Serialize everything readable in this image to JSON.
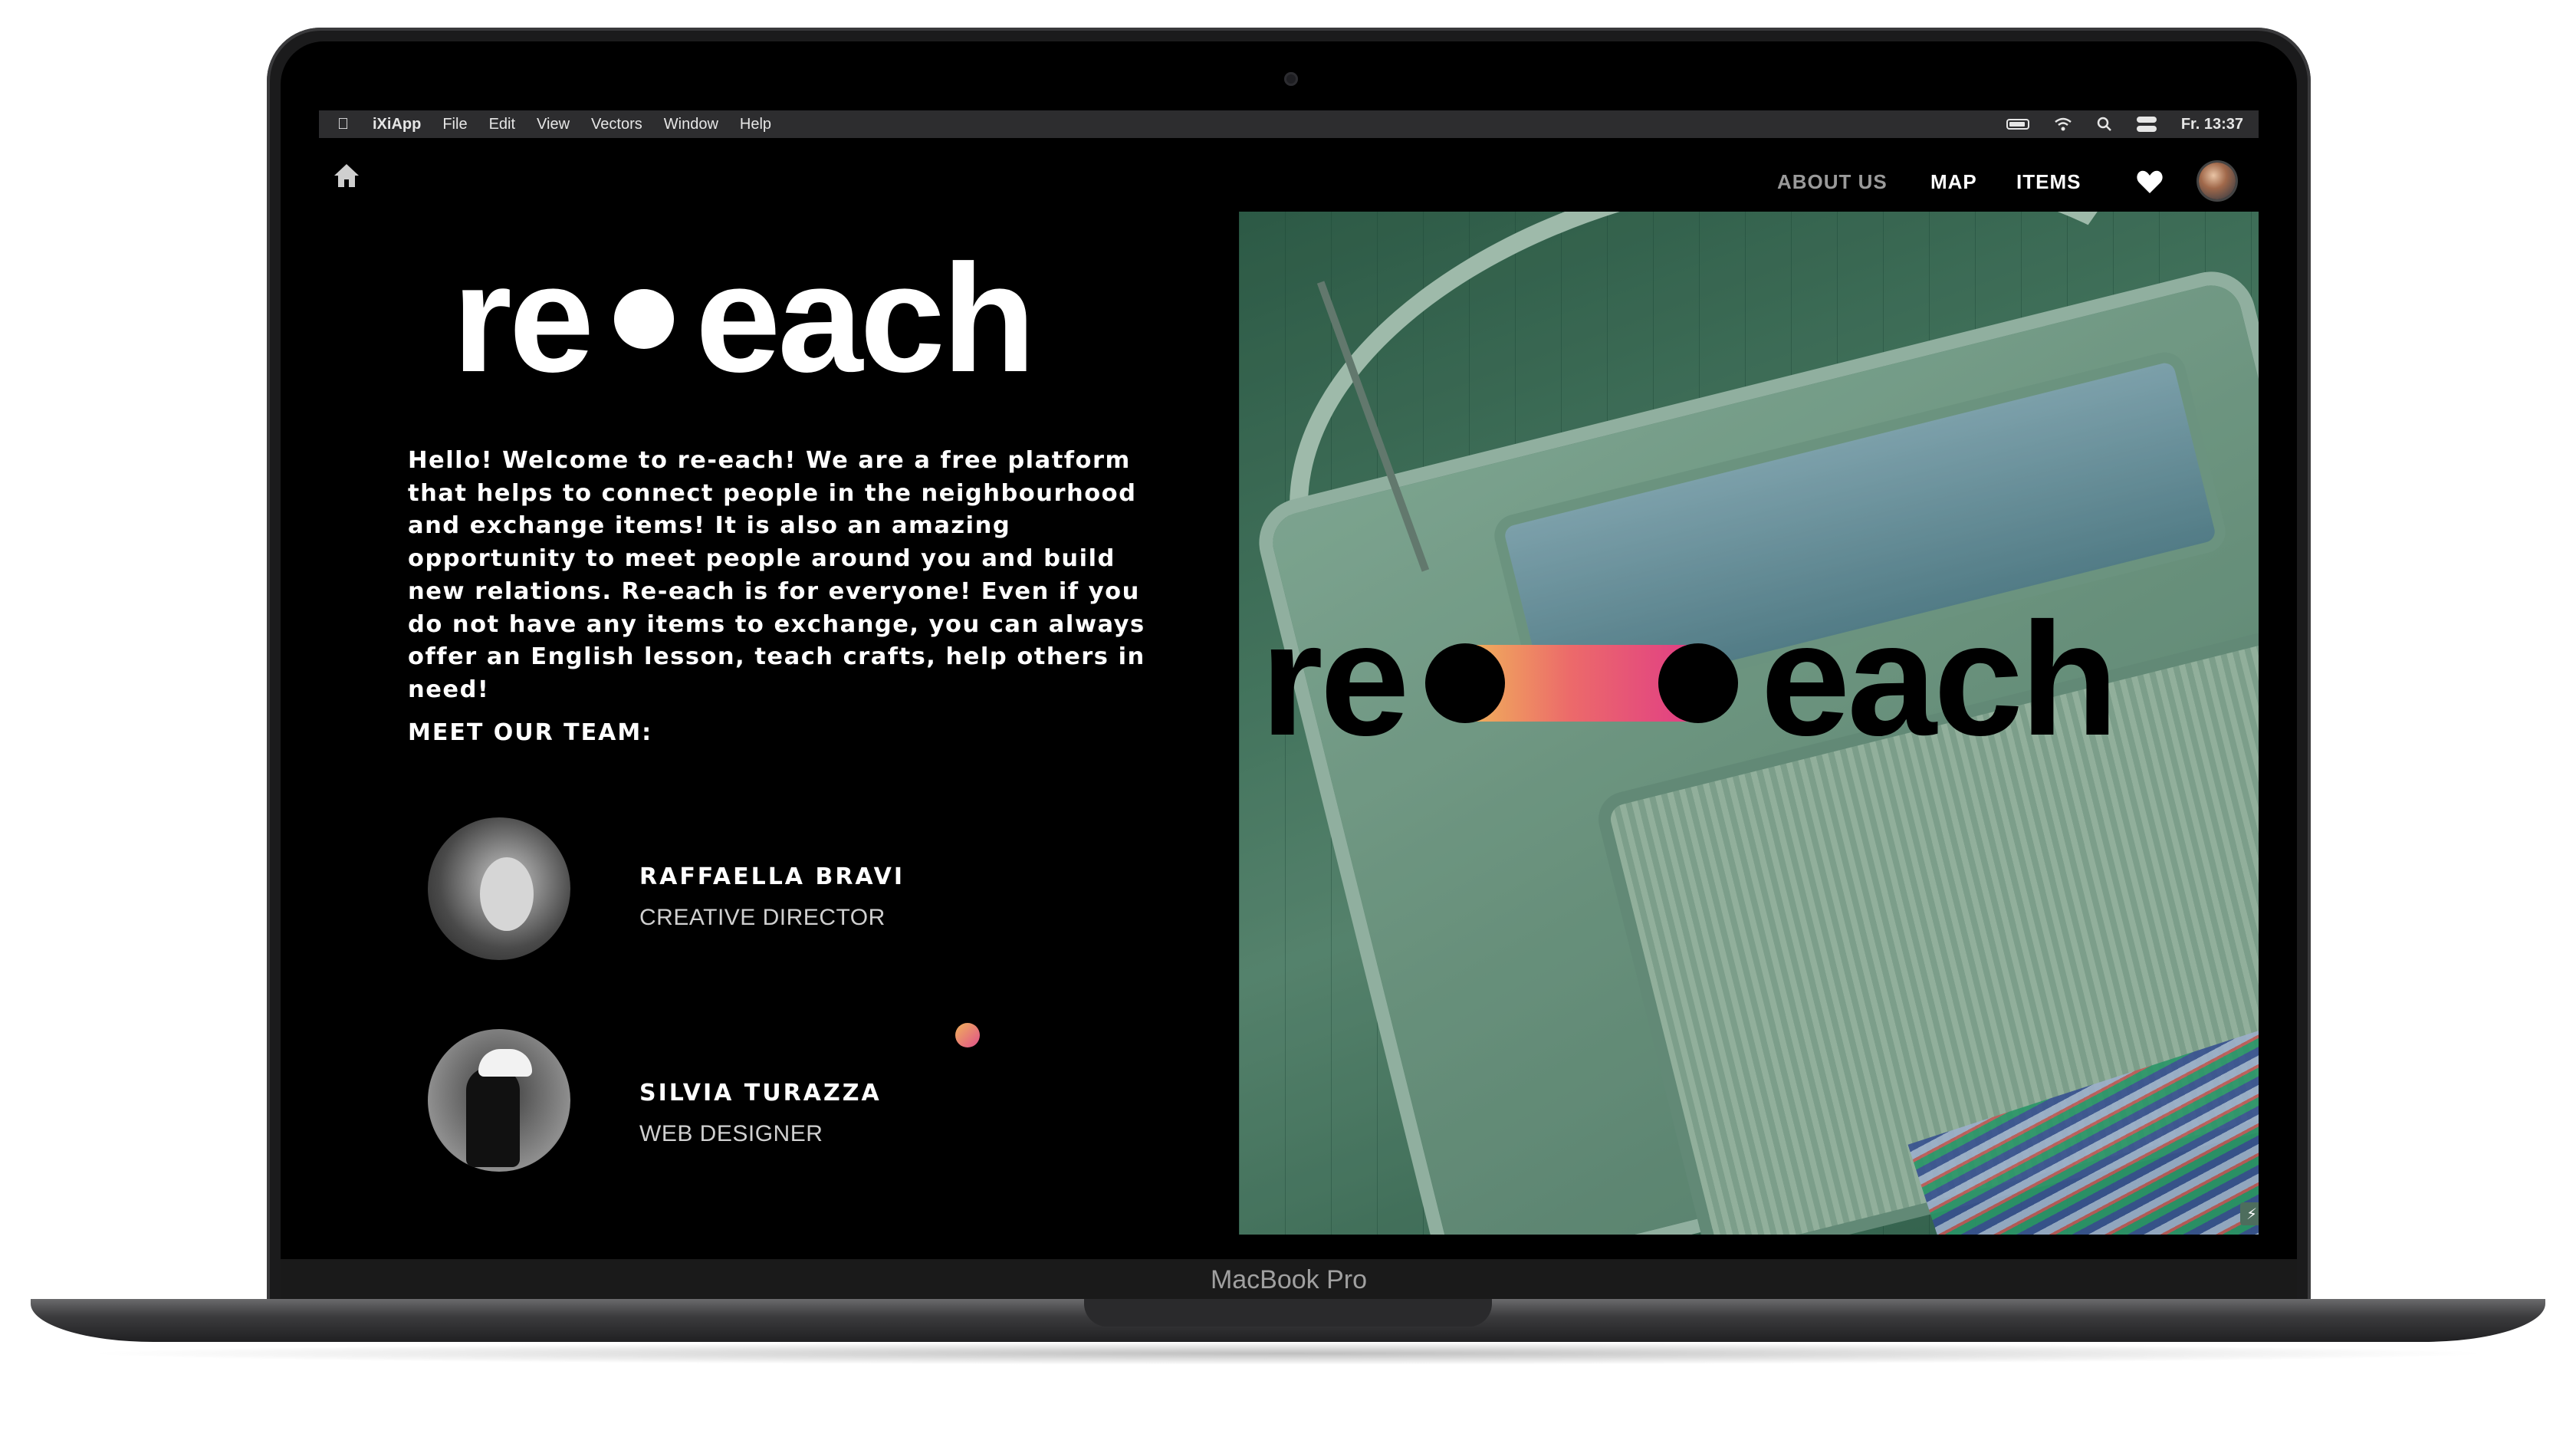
{
  "device": {
    "label": "MacBook Pro"
  },
  "menubar": {
    "app_name": "iXiApp",
    "items": [
      "File",
      "Edit",
      "View",
      "Vectors",
      "Window",
      "Help"
    ],
    "clock": "Fr. 13:37"
  },
  "nav": {
    "about": "ABOUT US",
    "map": "MAP",
    "items": "ITEMS"
  },
  "logo": {
    "left": "re",
    "right": "each"
  },
  "intro": "Hello! Welcome to re-each! We are a free platform that helps to connect people in the neighbourhood and exchange items! It is also an amazing opportunity to meet people around you and build new relations. Re-each is for everyone! Even if you do not have any items to exchange, you can always offer an English lesson, teach crafts, help others in need!",
  "team": {
    "heading": "MEET OUR TEAM:",
    "members": [
      {
        "name": "RAFFAELLA BRAVI",
        "role": "CREATIVE DIRECTOR"
      },
      {
        "name": "SILVIA TURAZZA",
        "role": "WEB DESIGNER"
      }
    ]
  },
  "hero_logo": {
    "left": "re",
    "right": "each"
  },
  "colors": {
    "accent_start": "#f0b45a",
    "accent_end": "#e03c86",
    "background": "#000000",
    "text": "#ffffff"
  },
  "icons": [
    "apple-icon",
    "battery-icon",
    "wifi-icon",
    "search-icon",
    "control-center-icon",
    "home-icon",
    "heart-icon",
    "bolt-icon"
  ]
}
